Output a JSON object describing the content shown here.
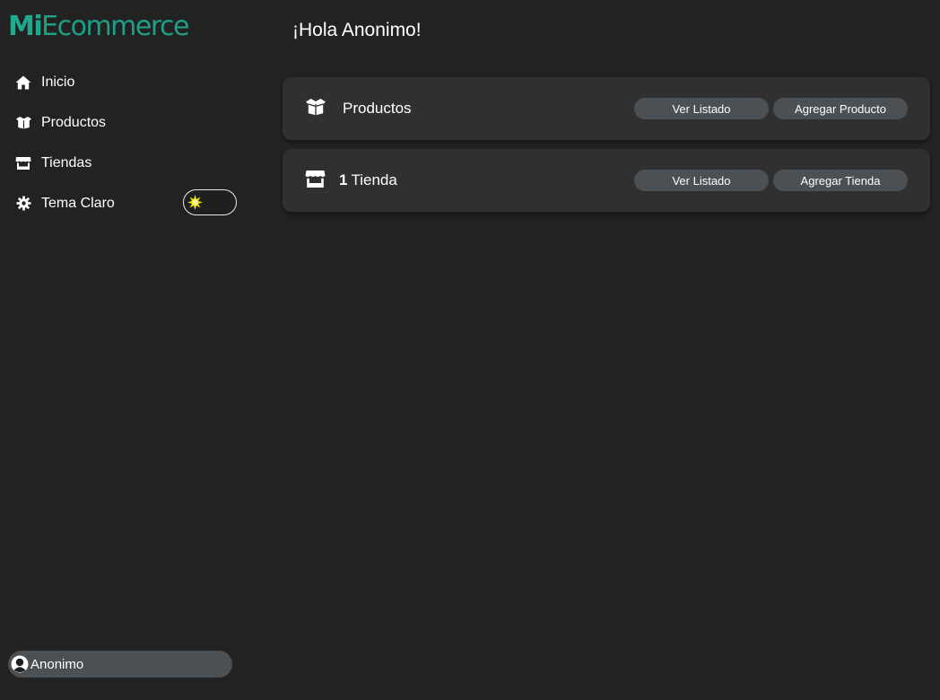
{
  "brand": {
    "logo_bold": "Mi",
    "logo_light": "Ecommerce",
    "color": "#1e9f86"
  },
  "sidebar": {
    "items": [
      {
        "label": "Inicio",
        "icon": "home-icon"
      },
      {
        "label": "Productos",
        "icon": "box-open-icon"
      },
      {
        "label": "Tiendas",
        "icon": "store-icon"
      },
      {
        "label": "Tema Claro",
        "icon": "gear-icon"
      }
    ],
    "theme_toggle": {
      "icon": "sun-icon",
      "state": "off"
    }
  },
  "user": {
    "name": "Anonimo",
    "icon": "user-icon"
  },
  "main": {
    "greeting": "¡Hola Anonimo!",
    "cards": [
      {
        "icon": "box-open-icon",
        "count": "",
        "title": "Productos",
        "actions": [
          "Ver Listado",
          "Agregar Producto"
        ]
      },
      {
        "icon": "store-icon",
        "count": "1",
        "title": "Tienda",
        "actions": [
          "Ver Listado",
          "Agregar Tienda"
        ]
      }
    ]
  },
  "colors": {
    "background": "#222222",
    "card": "#313031",
    "pill": "#4a5054",
    "accent": "#1e9f86"
  }
}
